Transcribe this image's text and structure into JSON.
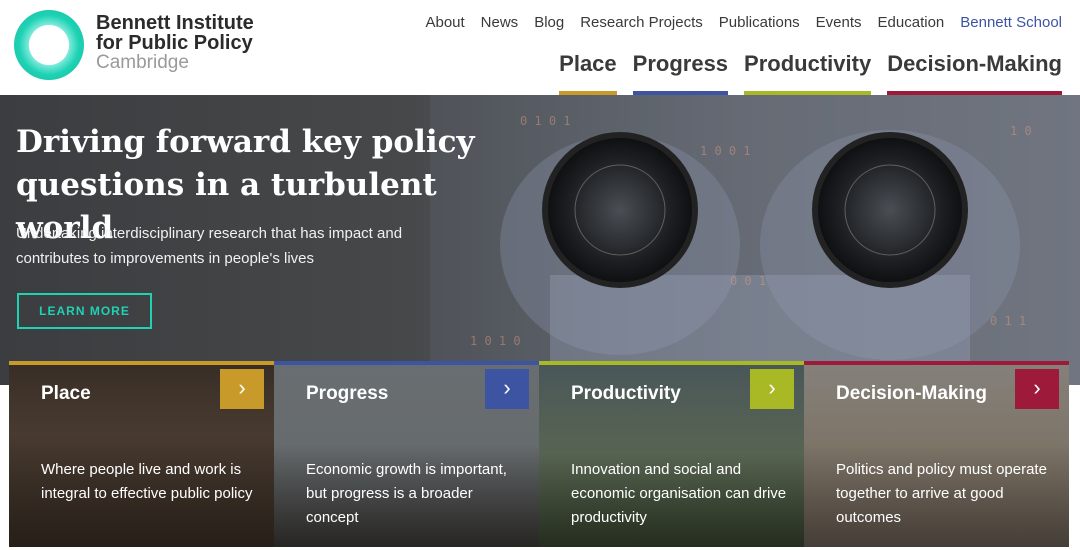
{
  "brand": {
    "line1": "Bennett Institute",
    "line2": "for Public Policy",
    "line3": "Cambridge"
  },
  "topnav": [
    "About",
    "News",
    "Blog",
    "Research Projects",
    "Publications",
    "Events",
    "Education",
    "Bennett School"
  ],
  "mainnav": [
    {
      "label": "Place",
      "color": "#c79a2a"
    },
    {
      "label": "Progress",
      "color": "#3d54a3"
    },
    {
      "label": "Productivity",
      "color": "#a9b825"
    },
    {
      "label": "Decision-Making",
      "color": "#9d1a3a"
    }
  ],
  "hero": {
    "title": "Driving forward key policy questions in a turbulent world",
    "text": "Undertaking interdisciplinary research that has impact and contributes to improvements in people's lives",
    "button": "LEARN MORE"
  },
  "cards": [
    {
      "title": "Place",
      "text": "Where people live and work is integral to effective public policy",
      "color": "#c79a2a",
      "arrow": "›"
    },
    {
      "title": "Progress",
      "text": "Economic growth is important, but progress is a broader concept",
      "color": "#3d54a3",
      "arrow": "›"
    },
    {
      "title": "Productivity",
      "text": "Innovation and social and economic organisation can drive productivity",
      "color": "#a9b825",
      "arrow": "›"
    },
    {
      "title": "Decision-Making",
      "text": "Politics and policy must operate together to arrive at good outcomes",
      "color": "#9d1a3a",
      "arrow": "›"
    }
  ],
  "colors": {
    "accent": "#1fd2b4",
    "school_link": "#3d54a3"
  }
}
